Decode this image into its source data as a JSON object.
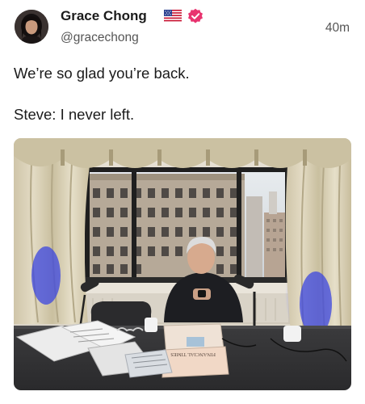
{
  "post": {
    "author": {
      "display_name": "Grace Chong",
      "handle": "@gracechong",
      "avatar_icon": "avatar-photo",
      "flag_icon": "us-flag-icon",
      "verified_icon": "verified-badge-icon",
      "verified_color": "#e8336f"
    },
    "timestamp": "40m",
    "text_lines": [
      "We’re so glad you’re back.",
      "Steve: I never left."
    ],
    "media": {
      "type": "photo",
      "newspaper_headline": "FINANCIAL TIMES"
    }
  }
}
